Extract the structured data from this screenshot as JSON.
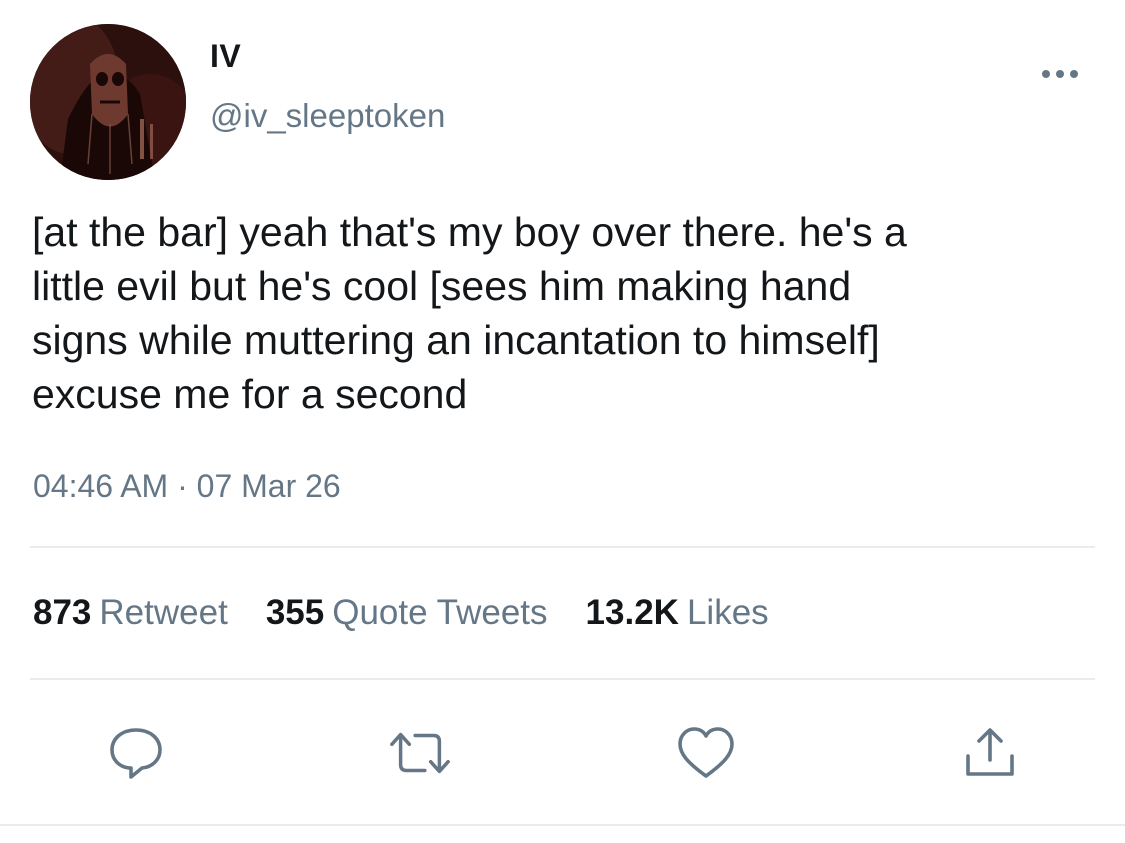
{
  "tweet": {
    "display_name": "IV",
    "handle": "@iv_sleeptoken",
    "text": "[at the bar] yeah that's my boy over there. he's a\nlittle evil but he's cool [sees him making hand\nsigns while muttering an incantation to himself]\nexcuse me for a second",
    "timestamp": "04:46 AM · 07 Mar 26"
  },
  "stats": {
    "retweets": {
      "count": "873",
      "label": "Retweet"
    },
    "quotes": {
      "count": "355",
      "label": "Quote Tweets"
    },
    "likes": {
      "count": "13.2K",
      "label": "Likes"
    }
  },
  "icons": {
    "more": "more-horizontal-icon",
    "reply": "reply-bubble-icon",
    "retweet": "retweet-arrows-icon",
    "like": "heart-outline-icon",
    "share": "share-upload-icon"
  },
  "colors": {
    "text_primary": "#14171a",
    "text_secondary": "#657786",
    "divider": "#e6ecf0"
  }
}
